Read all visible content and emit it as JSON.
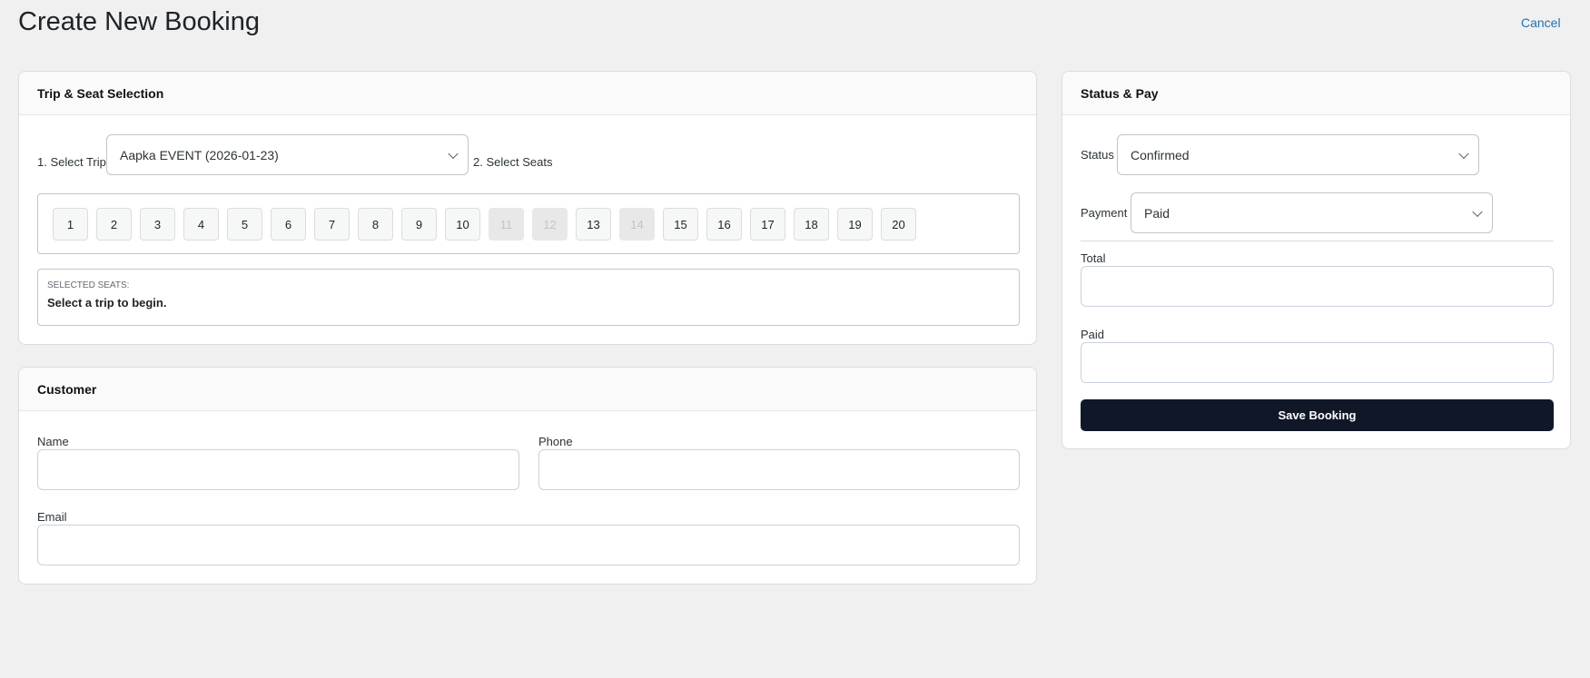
{
  "header": {
    "title": "Create New Booking",
    "cancel_label": "Cancel"
  },
  "trip_card": {
    "title": "Trip & Seat Selection",
    "select_trip_label": "1. Select Trip",
    "trip_value": "Aapka EVENT (2026-01-23)",
    "select_seats_label": "2. Select Seats",
    "seats": [
      {
        "n": "1",
        "disabled": false
      },
      {
        "n": "2",
        "disabled": false
      },
      {
        "n": "3",
        "disabled": false
      },
      {
        "n": "4",
        "disabled": false
      },
      {
        "n": "5",
        "disabled": false
      },
      {
        "n": "6",
        "disabled": false
      },
      {
        "n": "7",
        "disabled": false
      },
      {
        "n": "8",
        "disabled": false
      },
      {
        "n": "9",
        "disabled": false
      },
      {
        "n": "10",
        "disabled": false
      },
      {
        "n": "11",
        "disabled": true
      },
      {
        "n": "12",
        "disabled": true
      },
      {
        "n": "13",
        "disabled": false
      },
      {
        "n": "14",
        "disabled": true
      },
      {
        "n": "15",
        "disabled": false
      },
      {
        "n": "16",
        "disabled": false
      },
      {
        "n": "17",
        "disabled": false
      },
      {
        "n": "18",
        "disabled": false
      },
      {
        "n": "19",
        "disabled": false
      },
      {
        "n": "20",
        "disabled": false
      }
    ],
    "selected_label": "SELECTED SEATS:",
    "selected_text": "Select a trip to begin."
  },
  "customer_card": {
    "title": "Customer",
    "name_label": "Name",
    "phone_label": "Phone",
    "email_label": "Email"
  },
  "status_card": {
    "title": "Status & Pay",
    "status_label": "Status",
    "status_value": "Confirmed",
    "payment_label": "Payment",
    "payment_value": "Paid",
    "total_label": "Total",
    "paid_label": "Paid",
    "save_label": "Save Booking"
  }
}
